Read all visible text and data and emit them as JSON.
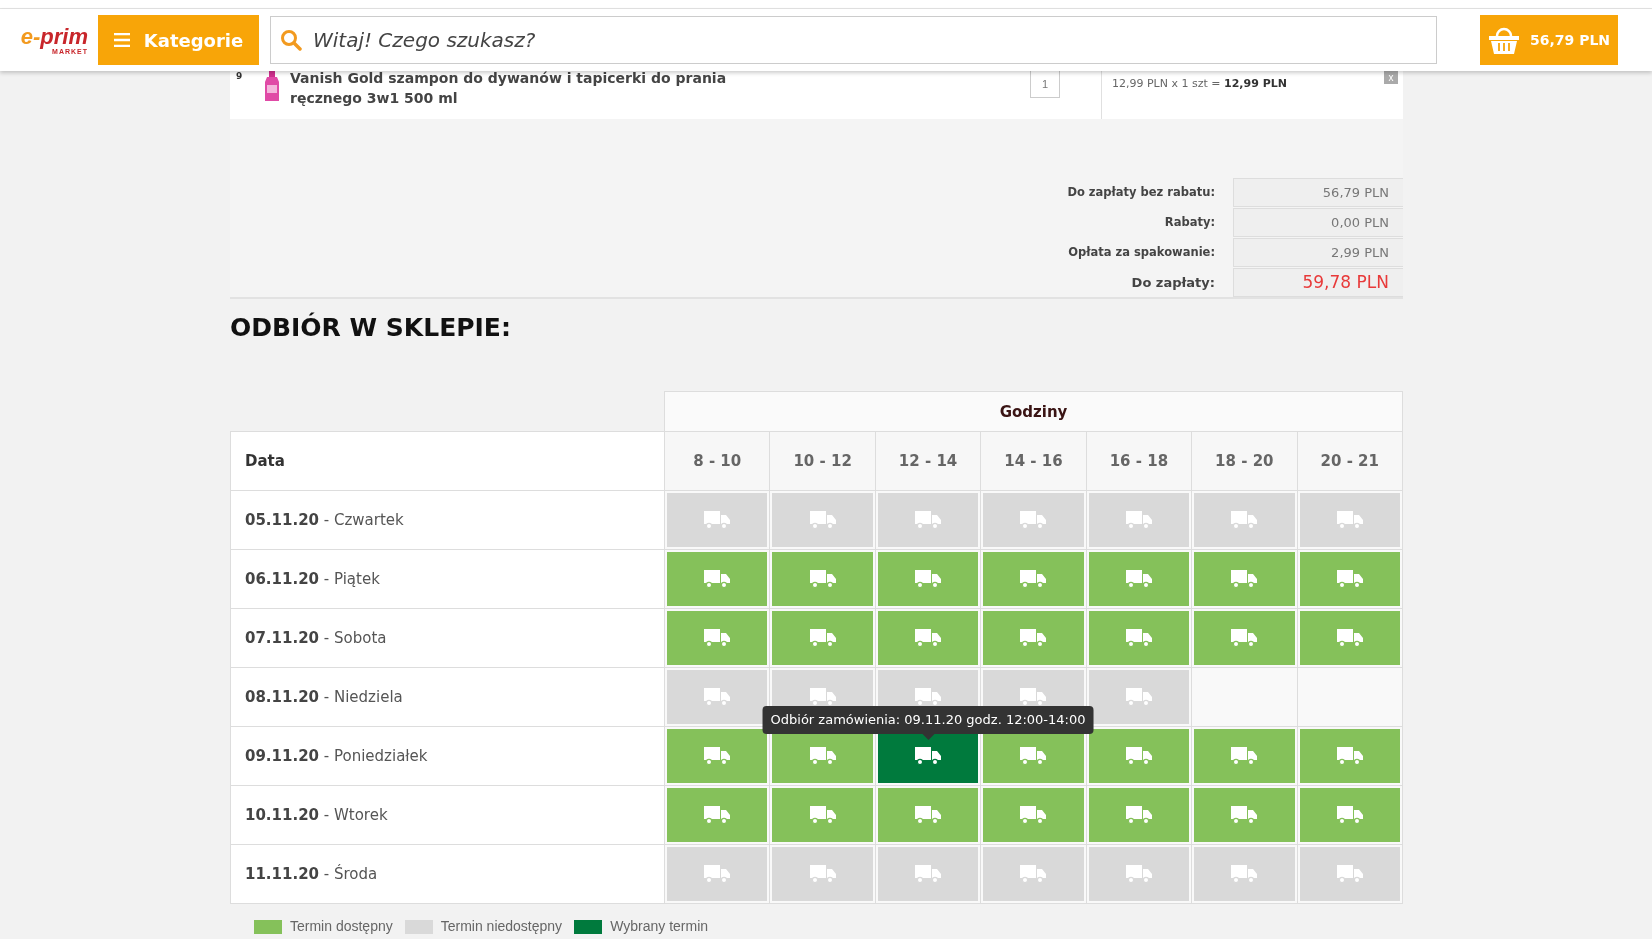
{
  "header": {
    "logo": {
      "prefix": "e-",
      "name": "prim",
      "tagline": "MARKET"
    },
    "menu_button": "Kategorie",
    "search": {
      "placeholder": "Witaj! Czego szukasz?"
    },
    "cart": "56,79 PLN"
  },
  "product": {
    "index": "9",
    "name": "Vanish Gold szampon do dywanów i tapicerki do prania ręcznego 3w1 500 ml",
    "quantity": "1",
    "price_line": "12,99 PLN x 1 szt = **12,99 PLN**",
    "remove": "x"
  },
  "summary": [
    {
      "kind": "line",
      "label": "Do zapłaty bez rabatu:",
      "value": "56,79 PLN"
    },
    {
      "kind": "line",
      "label": "Rabaty:",
      "value": "0,00 PLN"
    },
    {
      "kind": "line",
      "label": "Opłata za spakowanie:",
      "value": "2,99 PLN"
    },
    {
      "kind": "total",
      "label": "Do zapłaty:",
      "value": "59,78 PLN"
    }
  ],
  "section_title": "ODBIÓR W SKLEPIE:",
  "table": {
    "group_header": "Godziny",
    "date_header": "Data",
    "columns": [
      "8 - 10",
      "10 - 12",
      "12 - 14",
      "14 - 16",
      "16 - 18",
      "18 - 20",
      "20 - 21"
    ],
    "rows": [
      {
        "date": "**05.11.20** - Czwartek",
        "slots": [
          {
            "kind": "slot",
            "available": false,
            "selected": false
          },
          {
            "kind": "slot",
            "available": false,
            "selected": false
          },
          {
            "kind": "slot",
            "available": false,
            "selected": false
          },
          {
            "kind": "slot",
            "available": false,
            "selected": false
          },
          {
            "kind": "slot",
            "available": false,
            "selected": false
          },
          {
            "kind": "slot",
            "available": false,
            "selected": false
          },
          {
            "kind": "slot",
            "available": false,
            "selected": false
          }
        ]
      },
      {
        "date": "**06.11.20** - Piątek",
        "slots": [
          {
            "kind": "slot",
            "available": true,
            "selected": false
          },
          {
            "kind": "slot",
            "available": true,
            "selected": false
          },
          {
            "kind": "slot",
            "available": true,
            "selected": false
          },
          {
            "kind": "slot",
            "available": true,
            "selected": false
          },
          {
            "kind": "slot",
            "available": true,
            "selected": false
          },
          {
            "kind": "slot",
            "available": true,
            "selected": false
          },
          {
            "kind": "slot",
            "available": true,
            "selected": false
          }
        ]
      },
      {
        "date": "**07.11.20** - Sobota",
        "slots": [
          {
            "kind": "slot",
            "available": true,
            "selected": false
          },
          {
            "kind": "slot",
            "available": true,
            "selected": false
          },
          {
            "kind": "slot",
            "available": true,
            "selected": false
          },
          {
            "kind": "slot",
            "available": true,
            "selected": false
          },
          {
            "kind": "slot",
            "available": true,
            "selected": false
          },
          {
            "kind": "slot",
            "available": true,
            "selected": false
          },
          {
            "kind": "slot",
            "available": true,
            "selected": false
          }
        ]
      },
      {
        "date": "**08.11.20** - Niedziela",
        "slots": [
          {
            "kind": "slot",
            "available": false,
            "selected": false
          },
          {
            "kind": "slot",
            "available": false,
            "selected": false
          },
          {
            "kind": "slot",
            "available": false,
            "selected": false
          },
          {
            "kind": "slot",
            "available": false,
            "selected": false
          },
          {
            "kind": "slot",
            "available": false,
            "selected": false
          },
          {
            "kind": "empty"
          },
          {
            "kind": "empty"
          }
        ]
      },
      {
        "date": "**09.11.20** - Poniedziałek",
        "slots": [
          {
            "kind": "slot",
            "available": true,
            "selected": false
          },
          {
            "kind": "slot",
            "available": true,
            "selected": false
          },
          {
            "kind": "slot",
            "available": true,
            "selected": true
          },
          {
            "kind": "slot",
            "available": true,
            "selected": false
          },
          {
            "kind": "slot",
            "available": true,
            "selected": false
          },
          {
            "kind": "slot",
            "available": true,
            "selected": false
          },
          {
            "kind": "slot",
            "available": true,
            "selected": false
          }
        ]
      },
      {
        "date": "**10.11.20** - Wtorek",
        "slots": [
          {
            "kind": "slot",
            "available": true,
            "selected": false
          },
          {
            "kind": "slot",
            "available": true,
            "selected": false
          },
          {
            "kind": "slot",
            "available": true,
            "selected": false
          },
          {
            "kind": "slot",
            "available": true,
            "selected": false
          },
          {
            "kind": "slot",
            "available": true,
            "selected": false
          },
          {
            "kind": "slot",
            "available": true,
            "selected": false
          },
          {
            "kind": "slot",
            "available": true,
            "selected": false
          }
        ]
      },
      {
        "date": "**11.11.20** - Środa",
        "slots": [
          {
            "kind": "slot",
            "available": false,
            "selected": false
          },
          {
            "kind": "slot",
            "available": false,
            "selected": false
          },
          {
            "kind": "slot",
            "available": false,
            "selected": false
          },
          {
            "kind": "slot",
            "available": false,
            "selected": false
          },
          {
            "kind": "slot",
            "available": false,
            "selected": false
          },
          {
            "kind": "slot",
            "available": false,
            "selected": false
          },
          {
            "kind": "slot",
            "available": false,
            "selected": false
          }
        ]
      }
    ]
  },
  "tooltip": "Odbiór zamówienia: 09.11.20 godz. 12:00-14:00",
  "legend": [
    {
      "color": "#85c15a",
      "label": "Termin dostępny"
    },
    {
      "color": "#d9d9d9",
      "label": "Termin niedostępny"
    },
    {
      "color": "#007a3d",
      "label": "Wybrany termin"
    }
  ]
}
